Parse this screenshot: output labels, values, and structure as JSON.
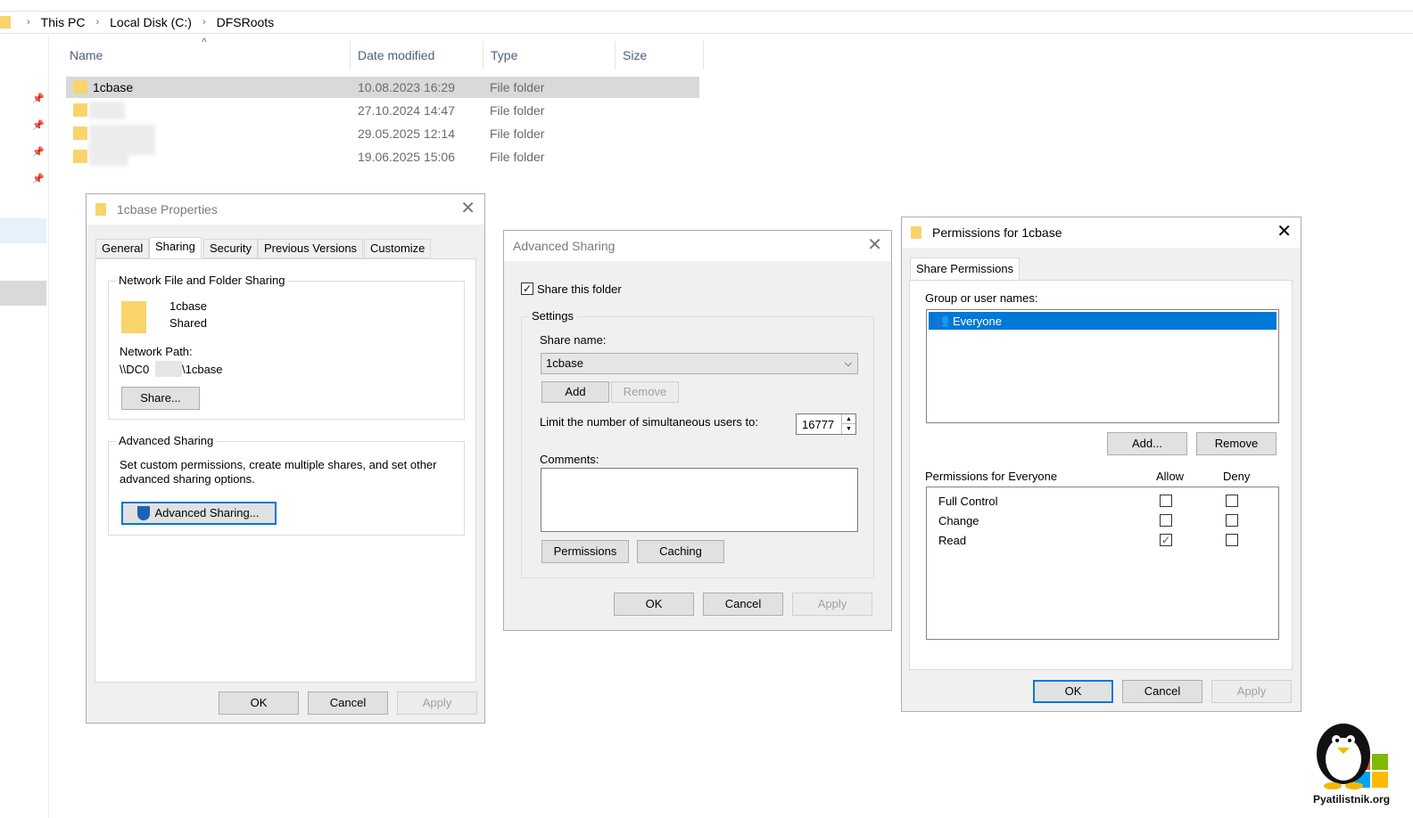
{
  "breadcrumb": {
    "items": [
      "This PC",
      "Local Disk (C:)",
      "DFSRoots"
    ]
  },
  "columns": {
    "name": "Name",
    "date": "Date modified",
    "type": "Type",
    "size": "Size"
  },
  "files": [
    {
      "name": "1cbase",
      "date": "10.08.2023 16:29",
      "type": "File folder"
    },
    {
      "name": "",
      "date": "27.10.2024 14:47",
      "type": "File folder"
    },
    {
      "name": "",
      "date": "29.05.2025 12:14",
      "type": "File folder"
    },
    {
      "name": "",
      "date": "19.06.2025 15:06",
      "type": "File folder"
    }
  ],
  "props": {
    "title": "1cbase Properties",
    "tabs": [
      "General",
      "Sharing",
      "Security",
      "Previous Versions",
      "Customize"
    ],
    "nffs_group": "Network File and Folder Sharing",
    "folder_name": "1cbase",
    "folder_status": "Shared",
    "network_path_label": "Network Path:",
    "network_path_start": "\\\\DC0",
    "network_path_end": "\\1cbase",
    "share_btn": "Share...",
    "adv_group": "Advanced Sharing",
    "adv_desc": "Set custom permissions, create multiple shares, and set other advanced sharing options.",
    "adv_btn": "Advanced Sharing...",
    "ok": "OK",
    "cancel": "Cancel",
    "apply": "Apply"
  },
  "adv": {
    "title": "Advanced Sharing",
    "share_this_folder": "Share this folder",
    "share_checked": true,
    "settings": "Settings",
    "share_name_label": "Share name:",
    "share_name": "1cbase",
    "add": "Add",
    "remove": "Remove",
    "limit_label": "Limit the number of simultaneous users to:",
    "limit_value": "16777",
    "comments_label": "Comments:",
    "permissions": "Permissions",
    "caching": "Caching",
    "ok": "OK",
    "cancel": "Cancel",
    "apply": "Apply"
  },
  "perm": {
    "title": "Permissions for 1cbase",
    "tab": "Share Permissions",
    "group_label": "Group or user names:",
    "users": [
      "Everyone"
    ],
    "add": "Add...",
    "remove": "Remove",
    "perm_for": "Permissions for Everyone",
    "allow": "Allow",
    "deny": "Deny",
    "rows": [
      {
        "name": "Full Control",
        "allow": false,
        "deny": false
      },
      {
        "name": "Change",
        "allow": false,
        "deny": false
      },
      {
        "name": "Read",
        "allow": true,
        "deny": false
      }
    ],
    "ok": "OK",
    "cancel": "Cancel",
    "apply": "Apply"
  },
  "watermark": "Pyatilistnik.org",
  "colors": {
    "accent": "#0078d7",
    "folder": "#f8d46a",
    "selection": "#d9d9d9"
  }
}
